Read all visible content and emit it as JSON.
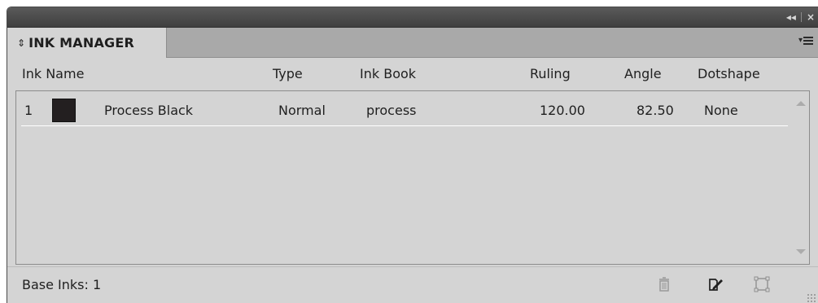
{
  "window": {
    "controls": {
      "collapse": "◂◂",
      "close": "×"
    }
  },
  "panel": {
    "tab": {
      "arrows": "⇕",
      "title": "INK MANAGER"
    },
    "menu": {
      "icon": "panel-menu-icon"
    }
  },
  "table": {
    "columns": {
      "ink_name": "Ink Name",
      "type": "Type",
      "ink_book": "Ink Book",
      "ruling": "Ruling",
      "angle": "Angle",
      "dotshape": "Dotshape"
    },
    "rows": [
      {
        "index": "1",
        "swatch_color": "#231f20",
        "ink_name": "Process Black",
        "type": "Normal",
        "ink_book": "process",
        "ruling": "120.00",
        "angle": "82.50",
        "dotshape": "None"
      }
    ]
  },
  "footer": {
    "base_inks": "Base Inks: 1",
    "buttons": {
      "delete": "trash-icon",
      "edit": "edit-icon",
      "new": "new-icon"
    }
  },
  "colors": {
    "panel_bg": "#d4d4d4",
    "titlebar": "#4a4a4a"
  }
}
